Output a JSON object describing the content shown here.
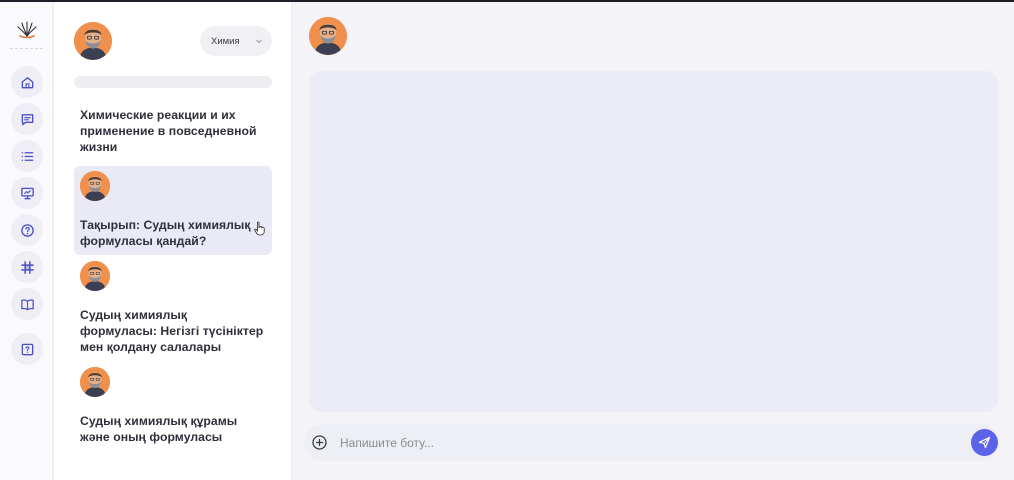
{
  "subject_select": {
    "value": "Химия"
  },
  "search": {
    "placeholder": ""
  },
  "conversations": [
    {
      "title": "Химические реакции и их применение в повседневной жизни",
      "has_avatar": false,
      "active": false
    },
    {
      "title": "Тақырып: Судың химиялық формуласы қандай?",
      "has_avatar": true,
      "active": true
    },
    {
      "title": "Судың химиялық формуласы: Негізгі түсініктер мен қолдану салалары",
      "has_avatar": true,
      "active": false
    },
    {
      "title": "Судың химиялық құрамы және оның формуласы",
      "has_avatar": true,
      "active": false
    }
  ],
  "nav": [
    {
      "icon": "home-icon"
    },
    {
      "icon": "chat-icon"
    },
    {
      "icon": "list-icon"
    },
    {
      "icon": "presentation-icon"
    },
    {
      "icon": "help-icon"
    },
    {
      "icon": "grid-icon"
    },
    {
      "icon": "book-icon"
    },
    {
      "icon": "quiz-icon"
    }
  ],
  "composer": {
    "placeholder": "Напишите боту..."
  },
  "colors": {
    "accent": "#5b63e8",
    "active_conversation": "#e9eaf6",
    "chat_panel": "#ececf6",
    "avatar_bg": "#f0904c",
    "nav_icon": "#4a4fc9"
  }
}
